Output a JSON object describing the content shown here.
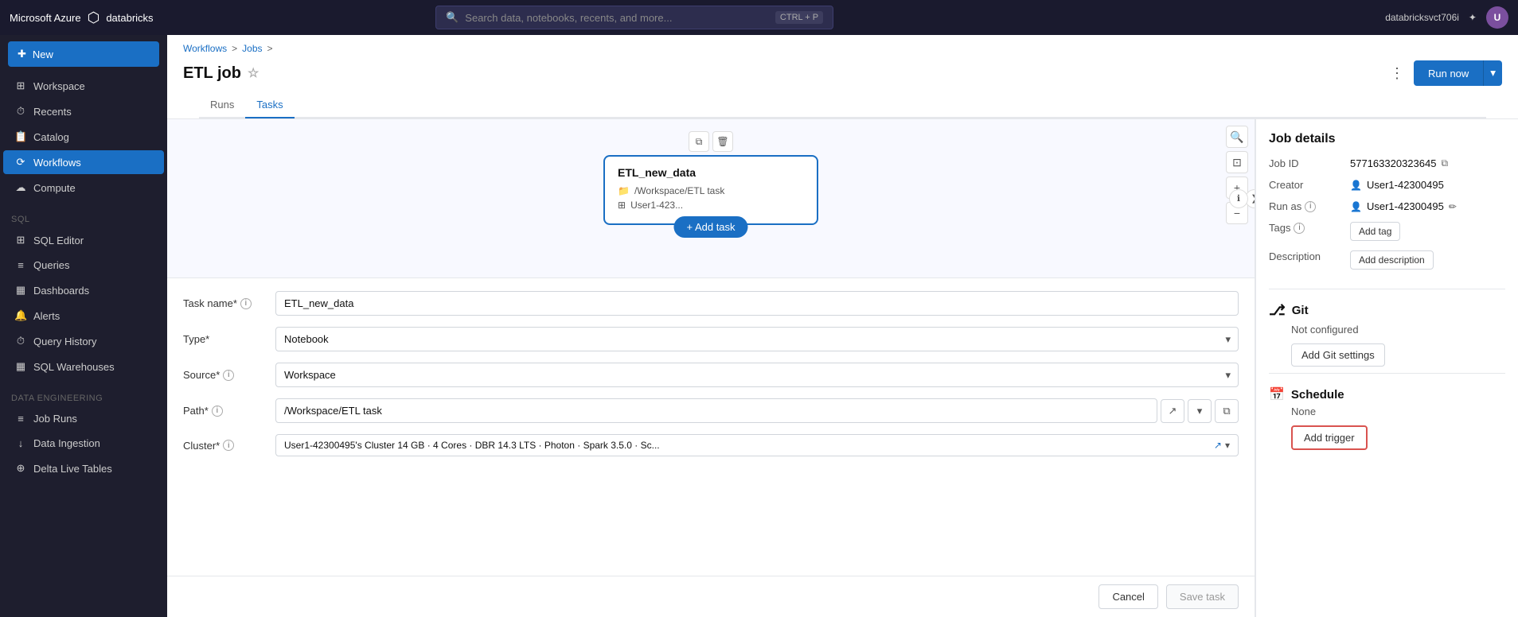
{
  "topbar": {
    "brand_azure": "Microsoft Azure",
    "brand_databricks": "databricks",
    "search_placeholder": "Search data, notebooks, recents, and more...",
    "search_shortcut": "CTRL + P",
    "user_account": "databricksvct706i",
    "avatar_initials": "U"
  },
  "sidebar": {
    "new_label": "New",
    "items": [
      {
        "id": "workspace",
        "label": "Workspace",
        "icon": "⊞"
      },
      {
        "id": "recents",
        "label": "Recents",
        "icon": "⏱"
      },
      {
        "id": "catalog",
        "label": "Catalog",
        "icon": "📋"
      },
      {
        "id": "workflows",
        "label": "Workflows",
        "icon": "⟳",
        "active": true
      }
    ],
    "compute_label": "Compute",
    "compute_icon": "☁",
    "sql_section": "SQL",
    "sql_items": [
      {
        "id": "sql-editor",
        "label": "SQL Editor",
        "icon": "⊞"
      },
      {
        "id": "queries",
        "label": "Queries",
        "icon": "≡"
      },
      {
        "id": "dashboards",
        "label": "Dashboards",
        "icon": "▦"
      },
      {
        "id": "alerts",
        "label": "Alerts",
        "icon": "🔔"
      },
      {
        "id": "query-history",
        "label": "Query History",
        "icon": "⏱"
      },
      {
        "id": "sql-warehouses",
        "label": "SQL Warehouses",
        "icon": "▦"
      }
    ],
    "data_engineering_section": "Data Engineering",
    "de_items": [
      {
        "id": "job-runs",
        "label": "Job Runs",
        "icon": "≡"
      },
      {
        "id": "data-ingestion",
        "label": "Data Ingestion",
        "icon": "↓"
      },
      {
        "id": "delta-live-tables",
        "label": "Delta Live Tables",
        "icon": "⊕"
      }
    ]
  },
  "breadcrumb": {
    "items": [
      "Workflows",
      "Jobs"
    ],
    "separators": [
      ">",
      ">"
    ]
  },
  "page": {
    "title": "ETL job",
    "star_icon": "☆"
  },
  "toolbar": {
    "dots_label": "⋮",
    "run_now_label": "Run now",
    "run_dropdown_icon": "▾"
  },
  "tabs": [
    {
      "id": "runs",
      "label": "Runs"
    },
    {
      "id": "tasks",
      "label": "Tasks",
      "active": true
    }
  ],
  "canvas": {
    "task_card": {
      "title": "ETL_new_data",
      "path": "/Workspace/ETL task",
      "user": "User1-423...",
      "add_task_label": "+ Add task"
    },
    "collapse_icon": "❮",
    "info_icon": "ℹ",
    "zoom_in": "+",
    "zoom_out": "−",
    "fit_icon": "⊡",
    "search_icon": "🔍",
    "copy_icon": "⧉",
    "delete_icon": "🗑"
  },
  "task_form": {
    "task_name_label": "Task name*",
    "task_name_info": "ⓘ",
    "task_name_value": "ETL_new_data",
    "type_label": "Type*",
    "type_value": "Notebook",
    "source_label": "Source*",
    "source_info": "ⓘ",
    "source_value": "Workspace",
    "path_label": "Path*",
    "path_info": "ⓘ",
    "path_value": "/Workspace/ETL task",
    "cluster_label": "Cluster*",
    "cluster_info": "ⓘ",
    "cluster_value": "User1-42300495's Cluster  14 GB · 4 Cores · DBR 14.3 LTS · Photon · Spark 3.5.0 · Sc...",
    "cancel_label": "Cancel",
    "save_label": "Save task"
  },
  "job_details": {
    "panel_title": "Job details",
    "job_id_label": "Job ID",
    "job_id_value": "577163320323645",
    "creator_label": "Creator",
    "creator_value": "User1-42300495",
    "run_as_label": "Run as",
    "run_as_info": "ⓘ",
    "run_as_value": "User1-42300495",
    "tags_label": "Tags",
    "tags_info": "ⓘ",
    "tags_btn": "Add tag",
    "description_label": "Description",
    "description_btn": "Add description",
    "git_title": "Git",
    "git_status": "Not configured",
    "git_btn": "Add Git settings",
    "schedule_title": "Schedule",
    "schedule_none": "None",
    "schedule_btn": "Add trigger"
  }
}
